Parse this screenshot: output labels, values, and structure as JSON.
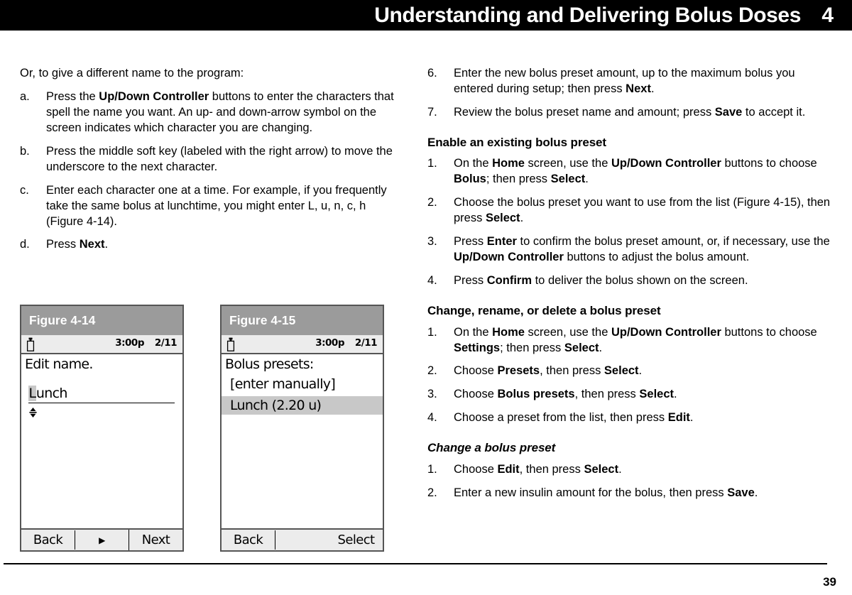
{
  "header": {
    "title": "Understanding and Delivering Bolus Doses",
    "chapter": "4"
  },
  "left_column": {
    "lead": "Or, to give a different name to the program:",
    "items": [
      {
        "marker": "a.",
        "parts": [
          {
            "t": "Press the ",
            "b": false
          },
          {
            "t": "Up/Down Controller",
            "b": true
          },
          {
            "t": " buttons to enter the characters that spell the name you want. An up- and down-arrow symbol on the screen indicates which character you are changing.",
            "b": false
          }
        ]
      },
      {
        "marker": "b.",
        "parts": [
          {
            "t": "Press the middle soft key (labeled with the right arrow) to move the underscore to the next character.",
            "b": false
          }
        ]
      },
      {
        "marker": "c.",
        "parts": [
          {
            "t": "Enter each character one at a time. For example, if you frequently take the same bolus at lunchtime, you might enter L, u, n, c, h (Figure 4-14).",
            "b": false
          }
        ]
      },
      {
        "marker": "d.",
        "parts": [
          {
            "t": "Press ",
            "b": false
          },
          {
            "t": "Next",
            "b": true
          },
          {
            "t": ".",
            "b": false
          }
        ]
      }
    ]
  },
  "right_column": {
    "items_top": [
      {
        "marker": "6.",
        "parts": [
          {
            "t": "Enter the new bolus preset amount, up to the maximum bolus you entered during setup; then press ",
            "b": false
          },
          {
            "t": "Next",
            "b": true
          },
          {
            "t": ".",
            "b": false
          }
        ]
      },
      {
        "marker": "7.",
        "parts": [
          {
            "t": "Review the bolus preset name and amount; press ",
            "b": false
          },
          {
            "t": "Save",
            "b": true
          },
          {
            "t": " to accept it.",
            "b": false
          }
        ]
      }
    ],
    "heading_enable": "Enable an existing bolus preset",
    "items_enable": [
      {
        "marker": "1.",
        "parts": [
          {
            "t": "On the ",
            "b": false
          },
          {
            "t": "Home",
            "b": true
          },
          {
            "t": " screen, use the ",
            "b": false
          },
          {
            "t": "Up/Down Controller",
            "b": true
          },
          {
            "t": " buttons to choose ",
            "b": false
          },
          {
            "t": "Bolus",
            "b": true
          },
          {
            "t": "; then press ",
            "b": false
          },
          {
            "t": "Select",
            "b": true
          },
          {
            "t": ".",
            "b": false
          }
        ]
      },
      {
        "marker": "2.",
        "parts": [
          {
            "t": "Choose the bolus preset you want to use from the list (Figure 4-15), then press ",
            "b": false
          },
          {
            "t": "Select",
            "b": true
          },
          {
            "t": ".",
            "b": false
          }
        ]
      },
      {
        "marker": "3.",
        "parts": [
          {
            "t": "Press ",
            "b": false
          },
          {
            "t": "Enter",
            "b": true
          },
          {
            "t": " to confirm the bolus preset amount, or, if necessary, use the ",
            "b": false
          },
          {
            "t": "Up/Down Controller",
            "b": true
          },
          {
            "t": " buttons to adjust the bolus amount.",
            "b": false
          }
        ]
      },
      {
        "marker": "4.",
        "parts": [
          {
            "t": "Press ",
            "b": false
          },
          {
            "t": "Confirm",
            "b": true
          },
          {
            "t": " to deliver the bolus shown on the screen.",
            "b": false
          }
        ]
      }
    ],
    "heading_change": "Change, rename, or delete a bolus preset",
    "items_change": [
      {
        "marker": "1.",
        "parts": [
          {
            "t": "On the ",
            "b": false
          },
          {
            "t": "Home",
            "b": true
          },
          {
            "t": " screen, use the ",
            "b": false
          },
          {
            "t": "Up/Down Controller",
            "b": true
          },
          {
            "t": " buttons to choose ",
            "b": false
          },
          {
            "t": "Settings",
            "b": true
          },
          {
            "t": "; then press ",
            "b": false
          },
          {
            "t": "Select",
            "b": true
          },
          {
            "t": ".",
            "b": false
          }
        ]
      },
      {
        "marker": "2.",
        "parts": [
          {
            "t": "Choose ",
            "b": false
          },
          {
            "t": "Presets",
            "b": true
          },
          {
            "t": ", then press ",
            "b": false
          },
          {
            "t": "Select",
            "b": true
          },
          {
            "t": ".",
            "b": false
          }
        ]
      },
      {
        "marker": "3.",
        "parts": [
          {
            "t": "Choose ",
            "b": false
          },
          {
            "t": "Bolus presets",
            "b": true
          },
          {
            "t": ", then press ",
            "b": false
          },
          {
            "t": "Select",
            "b": true
          },
          {
            "t": ".",
            "b": false
          }
        ]
      },
      {
        "marker": "4.",
        "parts": [
          {
            "t": "Choose a preset from the list, then press ",
            "b": false
          },
          {
            "t": "Edit",
            "b": true
          },
          {
            "t": ".",
            "b": false
          }
        ]
      }
    ],
    "heading_change_preset": "Change a bolus preset",
    "items_change_preset": [
      {
        "marker": "1.",
        "parts": [
          {
            "t": "Choose ",
            "b": false
          },
          {
            "t": "Edit",
            "b": true
          },
          {
            "t": ", then press ",
            "b": false
          },
          {
            "t": "Select",
            "b": true
          },
          {
            "t": ".",
            "b": false
          }
        ]
      },
      {
        "marker": "2.",
        "parts": [
          {
            "t": "Enter a new insulin amount for the bolus, then press ",
            "b": false
          },
          {
            "t": "Save",
            "b": true
          },
          {
            "t": ".",
            "b": false
          }
        ]
      }
    ]
  },
  "figure_a": {
    "caption": "Figure 4-14",
    "status": {
      "icon": "insulin-vial-icon",
      "time": "3:00p",
      "date": "2/11"
    },
    "screen_title": "Edit name.",
    "value_highlighted": "L",
    "value_rest": "unch",
    "softkeys": {
      "left": "Back",
      "middle": "▶",
      "right": "Next"
    }
  },
  "figure_b": {
    "caption": "Figure 4-15",
    "status": {
      "icon": "insulin-vial-icon",
      "time": "3:00p",
      "date": "2/11"
    },
    "screen_title": "Bolus presets:",
    "option_manual": "[enter manually]",
    "option_selected": "Lunch (2.20 u)",
    "softkeys": {
      "left": "Back",
      "middle": "",
      "right": "Select"
    }
  },
  "footer": {
    "page_number": "39"
  },
  "colors": {
    "header_bg": "#000000",
    "header_fg": "#ffffff",
    "caption_bg": "#9b9b9b",
    "statusbar_bg": "#ececec",
    "highlight": "#c8c8c8",
    "frame": "#555555"
  }
}
